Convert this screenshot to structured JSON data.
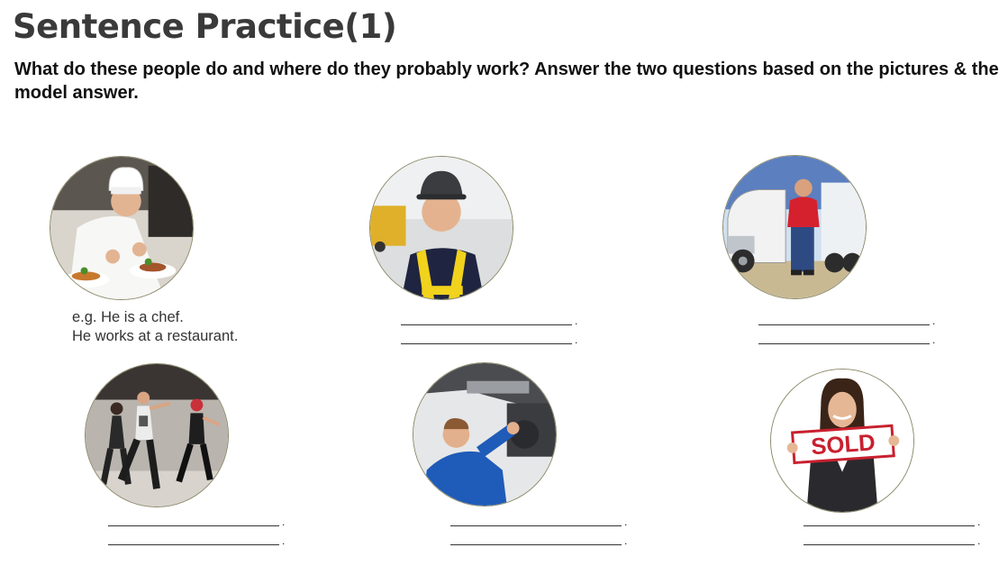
{
  "page": {
    "title": "Sentence Practice(1)",
    "instructions": "What do these people do and where do they probably work? Answer the two questions based on the pictures & the model answer."
  },
  "example": {
    "line1": "e.g. He is a chef.",
    "line2": "He works at a restaurant."
  },
  "answer_blank": {
    "terminator": "."
  },
  "pictures": [
    {
      "icon": "chef-photo-icon"
    },
    {
      "icon": "construction-worker-photo-icon"
    },
    {
      "icon": "truck-driver-photo-icon"
    },
    {
      "icon": "dancers-photo-icon"
    },
    {
      "icon": "mechanic-photo-icon"
    },
    {
      "icon": "real-estate-agent-photo-icon",
      "sign_text": "SOLD"
    }
  ],
  "colors": {
    "photo_border": "#8c8a6a",
    "sold_sign_red": "#c8202f"
  }
}
